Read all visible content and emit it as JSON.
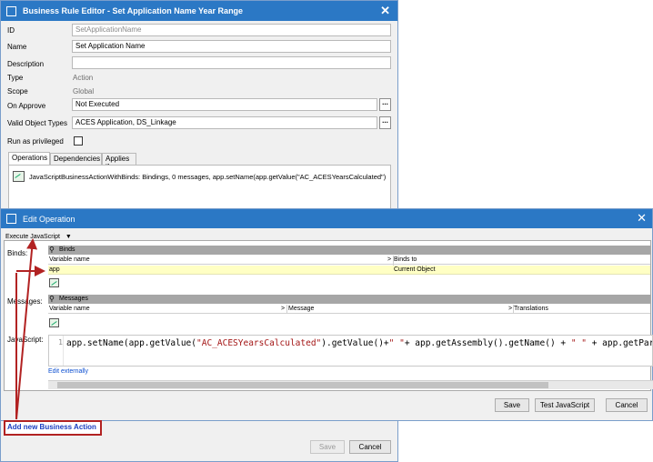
{
  "rule_editor": {
    "title": "Business Rule Editor - Set Application Name Year Range",
    "fields": {
      "id_label": "ID",
      "id_value": "SetApplicationName",
      "name_label": "Name",
      "name_value": "Set Application Name",
      "description_label": "Description",
      "description_value": "",
      "type_label": "Type",
      "type_value": "Action",
      "scope_label": "Scope",
      "scope_value": "Global",
      "on_approve_label": "On Approve",
      "on_approve_value": "Not Executed",
      "valid_object_types_label": "Valid Object Types",
      "valid_object_types_value": "ACES Application, DS_Linkage",
      "run_as_privileged_label": "Run as privileged",
      "run_as_privileged_checked": false
    },
    "browse_label": "...",
    "tabs": [
      {
        "label": "Operations",
        "active": true
      },
      {
        "label": "Dependencies",
        "active": false
      },
      {
        "label": "Applies if",
        "active": false
      }
    ],
    "operation_summary": "JavaScriptBusinessActionWithBinds: Bindings, 0 messages, app.setName(app.getValue(\"AC_ACESYearsCalculated\")",
    "add_new_business_action": "Add new Business Action",
    "save_label": "Save",
    "cancel_label": "Cancel"
  },
  "edit_operation": {
    "title": "Edit Operation",
    "operation_type": "Execute JavaScript",
    "binds_label": "Binds:",
    "binds_group": "Binds",
    "binds_columns": [
      "Variable name",
      "Binds to"
    ],
    "binds_rows": [
      {
        "variable": "app",
        "binds_to": "Current Object"
      }
    ],
    "messages_label": "Messages:",
    "messages_group": "Messages",
    "messages_columns": [
      "Variable name",
      "Message",
      "Translations"
    ],
    "sort_glyph": ">",
    "javascript_label": "JavaScript:",
    "code_line_number": "1",
    "code_parts": {
      "p1": "app.setName(app.getValue(",
      "s1": "\"AC_ACESYearsCalculated\"",
      "p2": ").getValue()+",
      "s2": "\" \"",
      "p3": "+ app.getAssembly().getName() + ",
      "s3": "\" \"",
      "p4": " + app.getPart().getName());"
    },
    "edit_externally": "Edit externally",
    "save_label": "Save",
    "test_label": "Test JavaScript",
    "cancel_label": "Cancel"
  },
  "colors": {
    "titlebar": "#2b78c5",
    "highlight_row": "#ffffc4",
    "annotation": "#b22222",
    "link": "#0b4ed0"
  }
}
